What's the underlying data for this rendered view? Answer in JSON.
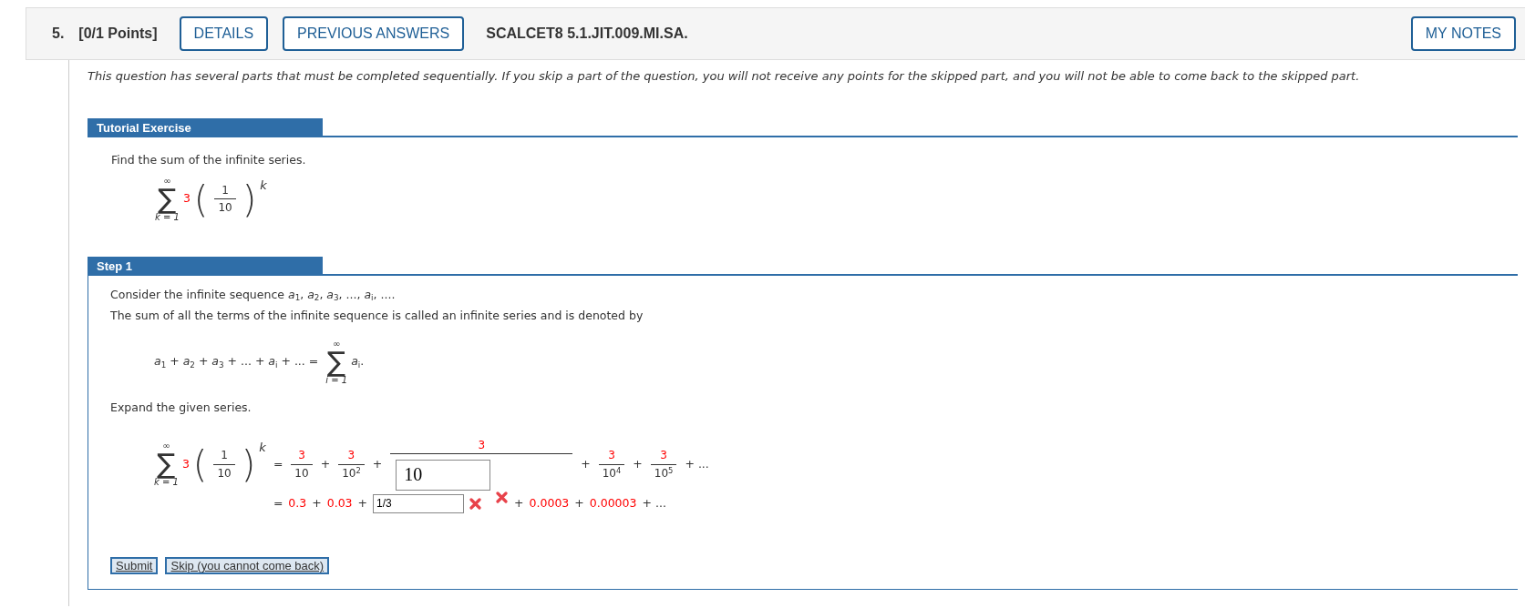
{
  "header": {
    "number": "5.",
    "points": "[0/1 Points]",
    "buttons": [
      "DETAILS",
      "PREVIOUS ANSWERS"
    ],
    "code": "SCALCET8 5.1.JIT.009.MI.SA.",
    "notes_button": "MY NOTES"
  },
  "intro": "This question has several parts that must be completed sequentially. If you skip a part of the question, you will not receive any points for the skipped part, and you will not be able to come back to the skipped part.",
  "tutorial": {
    "title": "Tutorial Exercise",
    "prompt": "Find the sum of the infinite series.",
    "series": {
      "upper": "∞",
      "sigma": "∑",
      "lower": "k = 1",
      "coefficient": "3",
      "left_paren": "(",
      "numerator": "1",
      "denominator": "10",
      "right_paren": ")",
      "exponent": "k"
    }
  },
  "step": {
    "title": "Step 1",
    "line1": "Consider the infinite sequence *a*$_{1}$, *a*$_{2}$, *a*$_{3}$, ..., *a*$_{i}$, ....",
    "line2": "The sum of all the terms of the infinite sequence is called an infinite series and is denoted by",
    "definition": {
      "left": "*a*$_{1}$ + *a*$_{2}$ + *a*$_{3}$ + ... + *a*$_{i}$ + ... =",
      "upper": "∞",
      "sigma": "∑",
      "lower": "i = 1",
      "term": "*a*$_{i}$."
    },
    "expand_prompt": "Expand the given series.",
    "expansion": {
      "series": {
        "upper": "∞",
        "sigma": "∑",
        "lower": "k = 1",
        "coefficient": "3",
        "left_paren": "(",
        "numerator": "1",
        "denominator": "10",
        "right_paren": ")",
        "exponent": "k"
      },
      "row1": [
        {
          "kind": "op",
          "text": "="
        },
        {
          "kind": "frac",
          "numerator": "3",
          "denominator": "10"
        },
        {
          "kind": "op",
          "text": "+"
        },
        {
          "kind": "frac",
          "numerator": "3",
          "denominator": "10$^{2}$"
        },
        {
          "kind": "op",
          "text": "+"
        },
        {
          "kind": "input_frac",
          "numerator": "3",
          "value": "10",
          "correct": false
        },
        {
          "kind": "op",
          "text": "+"
        },
        {
          "kind": "frac",
          "numerator": "3",
          "denominator": "10$^{4}$"
        },
        {
          "kind": "op",
          "text": "+"
        },
        {
          "kind": "frac",
          "numerator": "3",
          "denominator": "10$^{5}$"
        },
        {
          "kind": "op",
          "text": "+ ..."
        }
      ],
      "row2": [
        {
          "kind": "op",
          "text": "="
        },
        {
          "kind": "num",
          "text": "0.3"
        },
        {
          "kind": "op",
          "text": "+"
        },
        {
          "kind": "num",
          "text": "0.03"
        },
        {
          "kind": "op",
          "text": "+"
        },
        {
          "kind": "input",
          "value": "1/3",
          "correct": false
        },
        {
          "kind": "op",
          "text": "+"
        },
        {
          "kind": "num",
          "text": "0.0003"
        },
        {
          "kind": "op",
          "text": "+"
        },
        {
          "kind": "num",
          "text": "0.00003"
        },
        {
          "kind": "op",
          "text": "+ ..."
        }
      ]
    },
    "buttons": [
      "Submit",
      "Skip (you cannot come back)"
    ]
  }
}
